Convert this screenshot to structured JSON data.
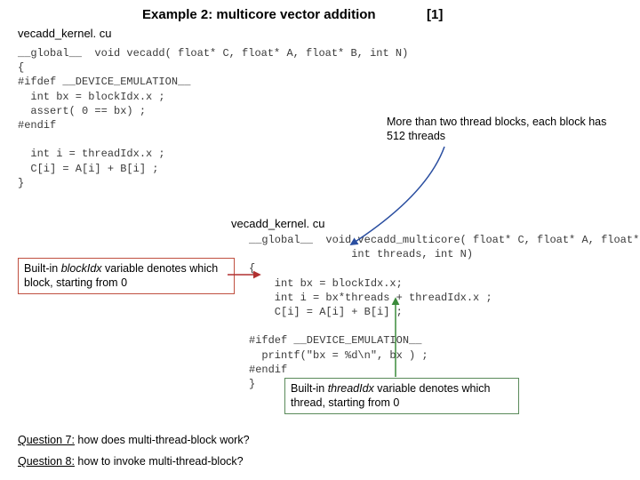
{
  "title": "Example 2: multicore vector addition",
  "title_ref": "[1]",
  "file1": "vecadd_kernel. cu",
  "code1": "__global__  void vecadd( float* C, float* A, float* B, int N)\n{\n#ifdef __DEVICE_EMULATION__\n  int bx = blockIdx.x ;\n  assert( 0 == bx) ;\n#endif\n\n  int i = threadIdx.x ;\n  C[i] = A[i] + B[i] ;\n}",
  "note1": "More than two thread blocks, each block has 512 threads",
  "file2": "vecadd_kernel. cu",
  "code2": "__global__  void vecadd_multicore( float* C, float* A, float* B,\n                int threads, int N)\n{\n    int bx = blockIdx.x;\n    int i = bx*threads + threadIdx.x ;\n    C[i] = A[i] + B[i] ;\n\n#ifdef __DEVICE_EMULATION__\n  printf(\"bx = %d\\n\", bx ) ;\n#endif\n}",
  "note2_pre": "Built-in ",
  "note2_var": "blockIdx",
  "note2_post": " variable denotes which block, starting from 0",
  "note3_pre": "Built-in ",
  "note3_var": "threadIdx",
  "note3_post": " variable denotes which thread, starting from 0",
  "q7_label": "Question 7:",
  "q7_text": " how does multi-thread-block work?",
  "q8_label": "Question 8:",
  "q8_text": " how to invoke multi-thread-block?"
}
